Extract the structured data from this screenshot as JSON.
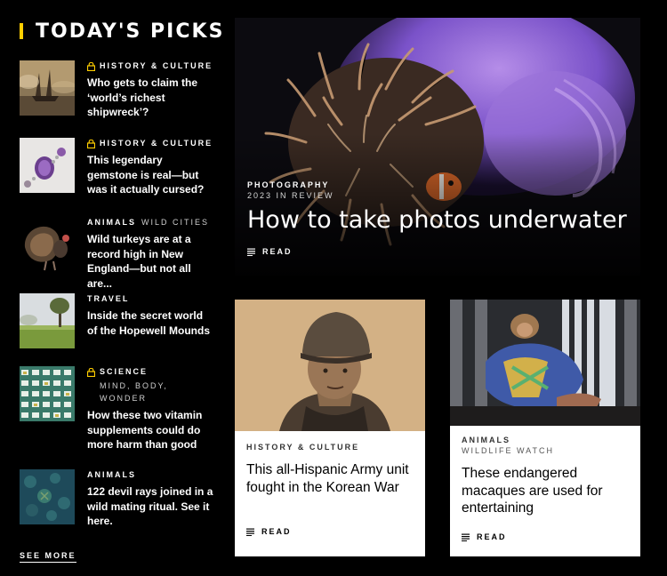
{
  "section": {
    "title": "TODAY'S PICKS"
  },
  "picks": [
    {
      "kicker": "HISTORY & CULTURE",
      "subkicker": "",
      "locked": true,
      "headline": "Who gets to claim the ‘world’s richest shipwreck’?",
      "thumb": "ship-painting"
    },
    {
      "kicker": "HISTORY & CULTURE",
      "subkicker": "",
      "locked": true,
      "headline": "This legendary gemstone is real—but was it actually cursed?",
      "thumb": "gemstone"
    },
    {
      "kicker": "ANIMALS",
      "subkicker": "WILD CITIES",
      "locked": false,
      "headline": "Wild turkeys are at a record high in New England—but not all are...",
      "thumb": "turkey"
    },
    {
      "kicker": "TRAVEL",
      "subkicker": "",
      "locked": false,
      "headline": "Inside the secret world of the Hopewell Mounds",
      "thumb": "mounds"
    },
    {
      "kicker": "SCIENCE",
      "subkicker": "MIND, BODY, WONDER",
      "locked": true,
      "headline": "How these two vitamin supplements could do more harm than good",
      "thumb": "pills"
    },
    {
      "kicker": "ANIMALS",
      "subkicker": "",
      "locked": false,
      "headline": "122 devil rays joined in a wild mating ritual. See it here.",
      "thumb": "rays"
    }
  ],
  "see_more": "SEE MORE",
  "hero": {
    "kicker": "PHOTOGRAPHY",
    "subkicker": "2023 IN REVIEW",
    "headline": "How to take photos underwater",
    "read": "READ"
  },
  "cards": [
    {
      "kicker": "HISTORY & CULTURE",
      "subkicker": "",
      "headline": "This all-Hispanic Army unit fought in the Korean War",
      "read": "READ"
    },
    {
      "kicker": "ANIMALS",
      "subkicker": "WILDLIFE WATCH",
      "headline": "These endangered macaques are used for entertaining",
      "read": "READ"
    }
  ],
  "colors": {
    "accent": "#ffce00",
    "background": "#000000"
  }
}
